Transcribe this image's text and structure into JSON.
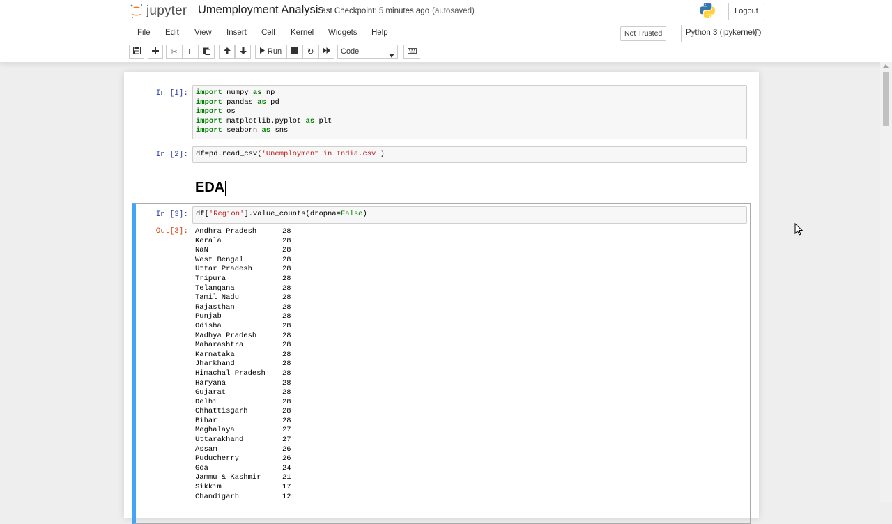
{
  "header": {
    "logo_text": "jupyter",
    "notebook_name": "Umemployment Analysis",
    "checkpoint": "Last Checkpoint: 5 minutes ago",
    "autosaved": "(autosaved)",
    "logout_label": "Logout"
  },
  "menubar": {
    "items": [
      "File",
      "Edit",
      "View",
      "Insert",
      "Cell",
      "Kernel",
      "Widgets",
      "Help"
    ],
    "trust_label": "Not Trusted",
    "kernel_label": "Python 3 (ipykernel)"
  },
  "toolbar": {
    "run_label": "Run",
    "cell_type": "Code",
    "icons": [
      "save-icon",
      "plus-icon",
      "cut-icon",
      "copy-icon",
      "paste-icon",
      "arrow-up-icon",
      "arrow-down-icon",
      "play-icon",
      "stop-icon",
      "restart-icon",
      "fast-forward-icon",
      "keyboard-icon"
    ]
  },
  "cells": {
    "cell1": {
      "prompt": "In [1]:",
      "lines": [
        {
          "kw": "import",
          "rest": " numpy ",
          "kw2": "as",
          "rest2": " np"
        },
        {
          "kw": "import",
          "rest": " pandas ",
          "kw2": "as",
          "rest2": " pd"
        },
        {
          "kw": "import",
          "rest": " os",
          "kw2": "",
          "rest2": ""
        },
        {
          "kw": "import",
          "rest": " matplotlib.pyplot ",
          "kw2": "as",
          "rest2": " plt"
        },
        {
          "kw": "import",
          "rest": " seaborn ",
          "kw2": "as",
          "rest2": " sns"
        }
      ]
    },
    "cell2": {
      "prompt": "In [2]:",
      "code_before": "df=pd.read_csv(",
      "code_string": "'Unemployment in India.csv'",
      "code_after": ")"
    },
    "markdown": {
      "heading": "EDA"
    },
    "cell3": {
      "prompt": "In [3]:",
      "code_before": "df[",
      "code_string": "'Region'",
      "code_middle": "].value_counts(dropna=",
      "code_keyword": "False",
      "code_after": ")",
      "out_prompt": "Out[3]:",
      "output": [
        {
          "region": "Andhra Pradesh",
          "count": "28"
        },
        {
          "region": "Kerala",
          "count": "28"
        },
        {
          "region": "NaN",
          "count": "28"
        },
        {
          "region": "West Bengal",
          "count": "28"
        },
        {
          "region": "Uttar Pradesh",
          "count": "28"
        },
        {
          "region": "Tripura",
          "count": "28"
        },
        {
          "region": "Telangana",
          "count": "28"
        },
        {
          "region": "Tamil Nadu",
          "count": "28"
        },
        {
          "region": "Rajasthan",
          "count": "28"
        },
        {
          "region": "Punjab",
          "count": "28"
        },
        {
          "region": "Odisha",
          "count": "28"
        },
        {
          "region": "Madhya Pradesh",
          "count": "28"
        },
        {
          "region": "Maharashtra",
          "count": "28"
        },
        {
          "region": "Karnataka",
          "count": "28"
        },
        {
          "region": "Jharkhand",
          "count": "28"
        },
        {
          "region": "Himachal Pradesh",
          "count": "28"
        },
        {
          "region": "Haryana",
          "count": "28"
        },
        {
          "region": "Gujarat",
          "count": "28"
        },
        {
          "region": "Delhi",
          "count": "28"
        },
        {
          "region": "Chhattisgarh",
          "count": "28"
        },
        {
          "region": "Bihar",
          "count": "28"
        },
        {
          "region": "Meghalaya",
          "count": "27"
        },
        {
          "region": "Uttarakhand",
          "count": "27"
        },
        {
          "region": "Assam",
          "count": "26"
        },
        {
          "region": "Puducherry",
          "count": "26"
        },
        {
          "region": "Goa",
          "count": "24"
        },
        {
          "region": "Jammu & Kashmir",
          "count": "21"
        },
        {
          "region": "Sikkim",
          "count": "17"
        },
        {
          "region": "Chandigarh",
          "count": "12"
        }
      ]
    }
  },
  "colors": {
    "selected_cell_border": "#42a5f5",
    "in_prompt": "#303f9f",
    "out_prompt": "#d84315",
    "keyword": "#008000",
    "string": "#ba2121",
    "logo_orange": "#f37726"
  }
}
